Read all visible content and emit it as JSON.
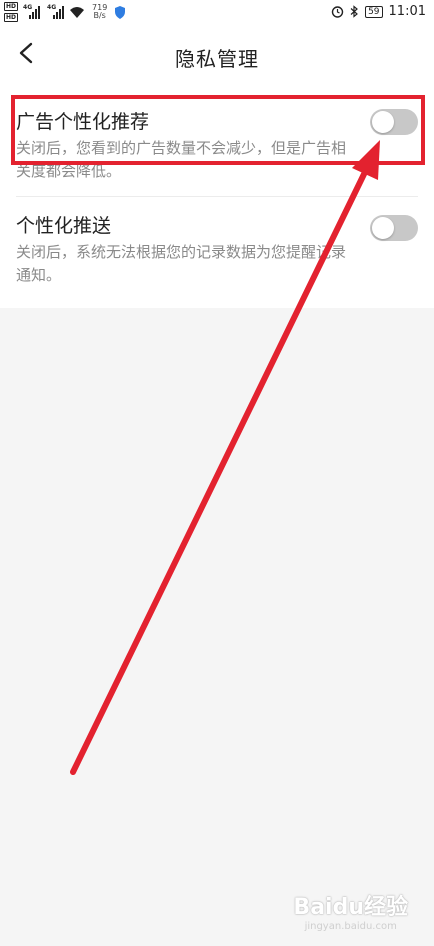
{
  "status_bar": {
    "hd1": "HD",
    "hd2": "HD",
    "net1": "4G",
    "net2": "4G",
    "speed_value": "719",
    "speed_unit": "B/s",
    "battery": "59",
    "time": "11:01"
  },
  "header": {
    "title": "隐私管理"
  },
  "settings": [
    {
      "title": "广告个性化推荐",
      "description": "关闭后，您看到的广告数量不会减少，但是广告相关度都会降低。",
      "toggle_on": false
    },
    {
      "title": "个性化推送",
      "description": "关闭后，系统无法根据您的记录数据为您提醒记录通知。",
      "toggle_on": false
    }
  ],
  "annotation": {
    "color": "#e3222f"
  },
  "watermark": {
    "logo": "Baidu经验",
    "sub": "jingyan.baidu.com"
  },
  "colors": {
    "toggle_off": "#c8c8c8",
    "background": "#f5f5f5"
  }
}
